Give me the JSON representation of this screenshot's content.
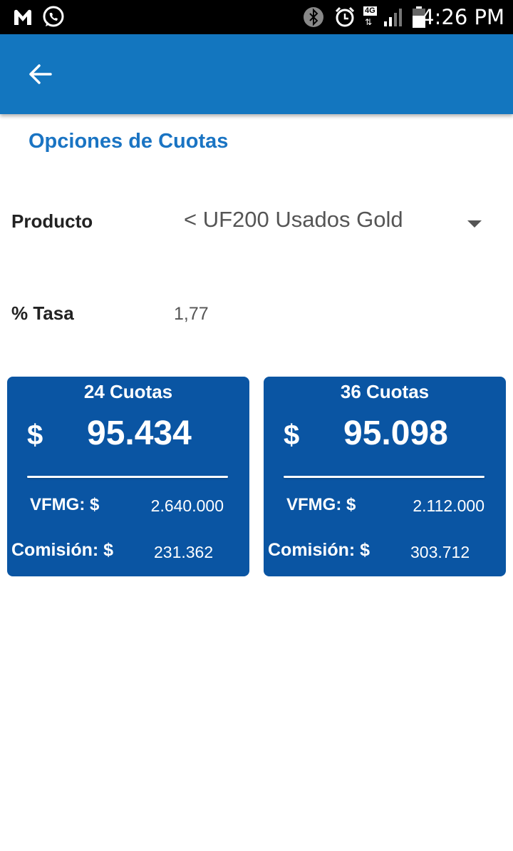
{
  "status_bar": {
    "time": "4:26 PM",
    "network_label": "4G",
    "icons": [
      "malwarebytes-icon",
      "whatsapp-icon",
      "bluetooth-icon",
      "alarm-icon",
      "signal-icon",
      "battery-icon"
    ]
  },
  "app_bar": {
    "back_icon": "arrow-left-icon",
    "color": "#1376bf"
  },
  "page": {
    "title": "Opciones de Cuotas",
    "product_label": "Producto",
    "product_value": "< UF200 Usados Gold",
    "rate_label": "% Tasa",
    "rate_value": "1,77"
  },
  "cards": [
    {
      "title": "24 Cuotas",
      "currency": "$",
      "amount": "95.434",
      "vfmg_label": "VFMG: $",
      "vfmg_value": "2.640.000",
      "commission_label": "Comisión: $",
      "commission_value": "231.362"
    },
    {
      "title": "36 Cuotas",
      "currency": "$",
      "amount": "95.098",
      "vfmg_label": "VFMG: $",
      "vfmg_value": "2.112.000",
      "commission_label": "Comisión: $",
      "commission_value": "303.712"
    }
  ],
  "colors": {
    "accent": "#1a74c3",
    "card": "#0a55a3",
    "text": "#222222"
  }
}
